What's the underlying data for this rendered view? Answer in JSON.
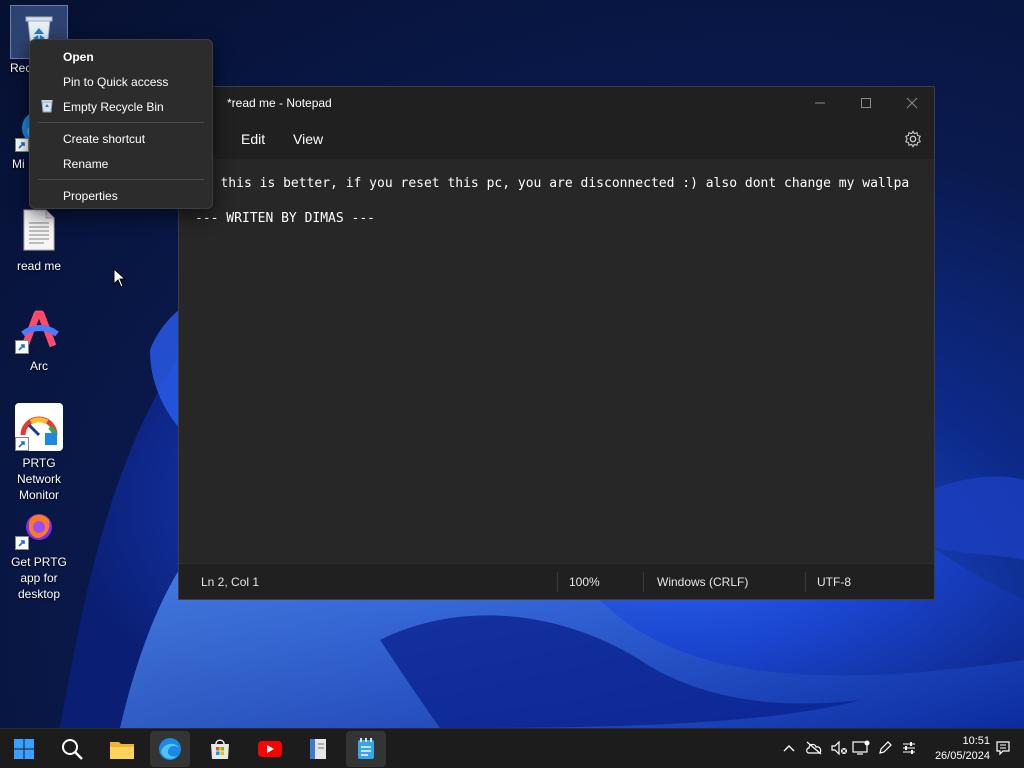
{
  "desktop": {
    "icons": [
      {
        "label": "Recycle Bin",
        "visible_label": "Rec",
        "type": "recycle-bin"
      },
      {
        "label": "Mi E",
        "type": "edge-shortcut"
      },
      {
        "label": "read me",
        "type": "text-file"
      },
      {
        "label": "Arc",
        "type": "arc-shortcut"
      },
      {
        "label": "PRTG Network Monitor",
        "type": "prtg-shortcut"
      },
      {
        "label": "Get PRTG app for desktop",
        "type": "firefox-shortcut"
      }
    ]
  },
  "context_menu": {
    "items": [
      "Open",
      "Pin to Quick access",
      "Empty Recycle Bin",
      "Create shortcut",
      "Rename",
      "Properties"
    ]
  },
  "notepad": {
    "title": "*read me - Notepad",
    "menu": [
      "Edit",
      "View"
    ],
    "lines": [
      "ys this is better, if you reset this pc, you are disconnected :) also dont change my wallpa",
      "--- WRITEN BY DIMAS ---"
    ],
    "status": {
      "position": "Ln 2, Col 1",
      "zoom": "100%",
      "line_ending": "Windows (CRLF)",
      "encoding": "UTF-8"
    }
  },
  "taskbar": {
    "apps": [
      "start-icon",
      "search-icon",
      "file-explorer-icon",
      "edge-icon",
      "microsoft-store-icon",
      "youtube-icon",
      "book-app-icon",
      "notepad-icon"
    ],
    "time": "10:51",
    "date": "26/05/2024"
  },
  "colors": {
    "accent": "#4cc2ff",
    "window_bg": "#272727",
    "titlebar_bg": "#202020"
  }
}
